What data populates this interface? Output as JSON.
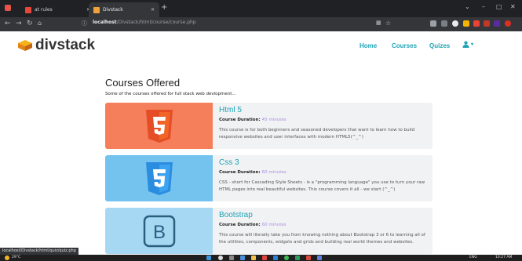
{
  "browser": {
    "tabs": [
      {
        "label": "at rules",
        "active": false
      },
      {
        "label": "Divstack",
        "active": true
      }
    ],
    "new_tab": "+",
    "url_host": "localhost",
    "url_path": "/Divstack/html/course/course.php",
    "window_controls": [
      "⌄",
      "–",
      "□",
      "✕"
    ]
  },
  "site": {
    "logo_text": "divstack",
    "nav": [
      {
        "label": "Home"
      },
      {
        "label": "Courses"
      },
      {
        "label": "Quizes"
      }
    ],
    "user_caret": "▾"
  },
  "page": {
    "title": "Courses Offered",
    "subtitle": "Some of the courses offered for full stack web devlopment..."
  },
  "courses": [
    {
      "title": "Html 5",
      "duration_label": "Course Duration:",
      "duration": "45 minutes",
      "description": "This course is for both beginners and seasoned developers that want to learn how to build responsive websites and user interfaces with modern HTML5(^_^)",
      "image_bg": "#f47f5a",
      "icon": "html5-icon",
      "icon_color": "#e44d26"
    },
    {
      "title": "Css 3",
      "duration_label": "Course Duration:",
      "duration": "60 minutes",
      "description": "CSS - short for Cascading Style Sheets - is a \"programming language\" you use to turn your raw HTML pages into real beautiful websites. This course covers it all - we start (^_^)",
      "image_bg": "#74c3ef",
      "icon": "css3-icon",
      "icon_color": "#2a8de0"
    },
    {
      "title": "Bootstrap",
      "duration_label": "Course Duration:",
      "duration": "60 minutes",
      "description": "This course will literally take you from knowing nothing about Bootstrap 3 or 6 to learning all of the utilities, components, widgets and grids and building real world themes and websites.",
      "image_bg": "#a6d8f3",
      "icon": "bootstrap-icon",
      "icon_color": "#2b5f7f"
    }
  ],
  "status_bar": {
    "text": "localhost/Divstack/html/quiz/quiz.php"
  },
  "taskbar": {
    "weather": "29°C",
    "time": "10:27 AM",
    "lang": "ENG"
  }
}
